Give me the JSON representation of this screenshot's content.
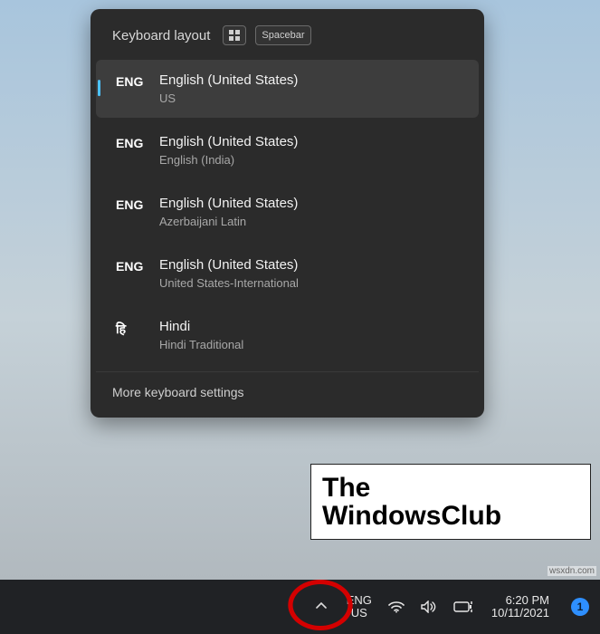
{
  "flyout": {
    "title": "Keyboard layout",
    "shortcut_key2": "Spacebar",
    "items": [
      {
        "code": "ENG",
        "name": "English (United States)",
        "sub": "US",
        "selected": true
      },
      {
        "code": "ENG",
        "name": "English (United States)",
        "sub": "English (India)",
        "selected": false
      },
      {
        "code": "ENG",
        "name": "English (United States)",
        "sub": "Azerbaijani Latin",
        "selected": false
      },
      {
        "code": "ENG",
        "name": "English (United States)",
        "sub": "United States-International",
        "selected": false
      },
      {
        "code": "हि",
        "name": "Hindi",
        "sub": "Hindi Traditional",
        "selected": false
      }
    ],
    "more": "More keyboard settings"
  },
  "taskbar": {
    "lang_code": "ENG",
    "lang_sub": "US",
    "time": "6:20 PM",
    "date": "10/11/2021",
    "notif_count": "1"
  },
  "watermark": {
    "line1": "The",
    "line2": "WindowsClub"
  },
  "attribution": "wsxdn.com"
}
